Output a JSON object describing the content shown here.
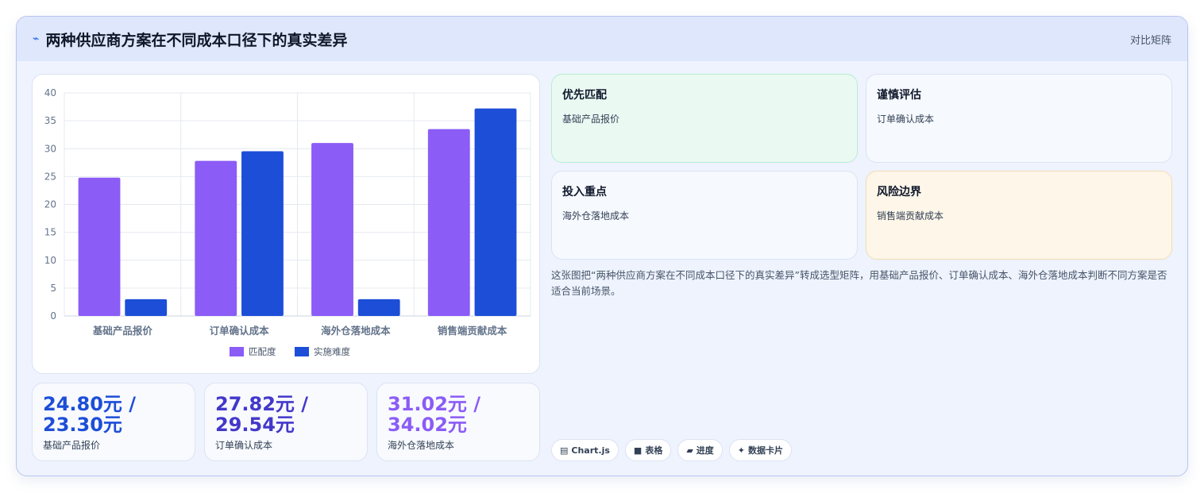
{
  "header": {
    "icon": "pulse-line-icon",
    "title": "两种供应商方案在不同成本口径下的真实差异",
    "tag": "对比矩阵"
  },
  "chart_data": {
    "type": "bar",
    "categories": [
      "基础产品报价",
      "订单确认成本",
      "海外仓落地成本",
      "销售端贡献成本"
    ],
    "series": [
      {
        "name": "匹配度",
        "values": [
          24.8,
          27.82,
          31.02,
          33.5
        ],
        "color": "#8b5cf6"
      },
      {
        "name": "实施难度",
        "values": [
          3,
          29.54,
          3,
          37.2
        ],
        "color": "#1d4ed8"
      }
    ],
    "ylim": [
      0,
      40
    ],
    "yticks": [
      "0",
      "5",
      "10",
      "15",
      "20",
      "25",
      "30",
      "35",
      "40"
    ],
    "legend_position": "bottom",
    "grid": true
  },
  "stats": [
    {
      "value": "24.80元 / 23.30元",
      "label": "基础产品报价",
      "color": "#1d4ed8"
    },
    {
      "value": "27.82元 / 29.54元",
      "label": "订单确认成本",
      "color": "#4338ca"
    },
    {
      "value": "31.02元 / 34.02元",
      "label": "海外仓落地成本",
      "color": "#8b5cf6"
    }
  ],
  "boxes": [
    {
      "title": "优先匹配",
      "text": "基础产品报价",
      "bg": "#eafaf3",
      "border": "#b7ecd3"
    },
    {
      "title": "谨慎评估",
      "text": "订单确认成本",
      "bg": "#f6f9fe",
      "border": "#dbe3f3"
    },
    {
      "title": "投入重点",
      "text": "海外仓落地成本",
      "bg": "#f6f9fe",
      "border": "#dbe3f3"
    },
    {
      "title": "风险边界",
      "text": "销售端贡献成本",
      "bg": "#fdf6e9",
      "border": "#f3dcb2"
    }
  ],
  "description": "这张图把“两种供应商方案在不同成本口径下的真实差异”转成选型矩阵，用基础产品报价、订单确认成本、海外仓落地成本判断不同方案是否适合当前场景。",
  "pills": [
    {
      "icon": "chart-icon",
      "glyph": "▤",
      "label": "Chart.js"
    },
    {
      "icon": "table-icon",
      "glyph": "■",
      "label": "表格"
    },
    {
      "icon": "progress-icon",
      "glyph": "▰",
      "label": "进度"
    },
    {
      "icon": "sparkle-icon",
      "glyph": "✦",
      "label": "数据卡片"
    }
  ]
}
